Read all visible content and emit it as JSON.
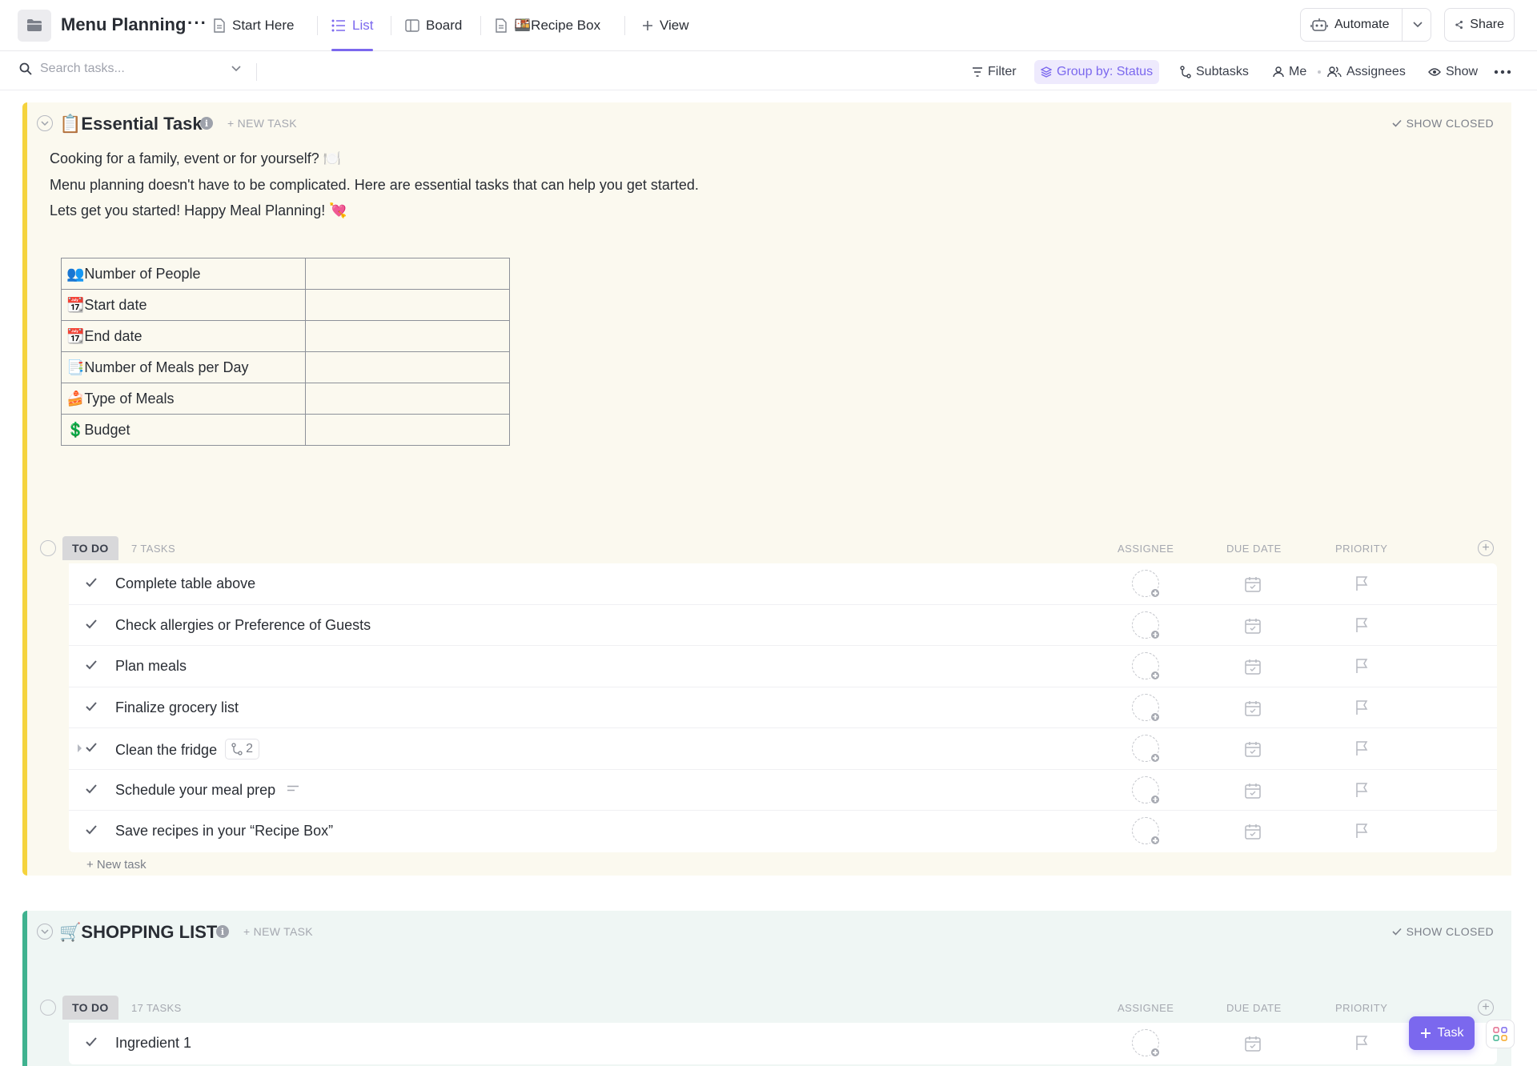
{
  "header": {
    "title": "Menu Planning",
    "title_more": "···",
    "tabs": [
      {
        "label": "Start Here",
        "icon": "doc-icon"
      },
      {
        "label": "List",
        "icon": "list-icon",
        "active": true
      },
      {
        "label": "Board",
        "icon": "board-icon"
      },
      {
        "label": "🍱Recipe Box",
        "icon": "doc-icon"
      },
      {
        "label": "View",
        "icon": "plus-icon"
      }
    ],
    "automate_label": "Automate",
    "share_label": "Share"
  },
  "toolbar": {
    "search_placeholder": "Search tasks...",
    "filter_label": "Filter",
    "group_label": "Group by: Status",
    "subtasks_label": "Subtasks",
    "me_label": "Me",
    "assignees_label": "Assignees",
    "show_label": "Show"
  },
  "essential": {
    "title": "📋Essential Task",
    "new_task_label": "+ NEW TASK",
    "show_closed": "SHOW CLOSED",
    "description": [
      "Cooking for a family, event or for yourself? 🍽️",
      "Menu planning doesn't have to be complicated. Here are essential tasks that can help you get started.",
      "Lets get you started! Happy Meal Planning! 💘"
    ],
    "table": [
      {
        "label": "👥Number of People",
        "value": ""
      },
      {
        "label": "📆Start date",
        "value": ""
      },
      {
        "label": "📆End date",
        "value": ""
      },
      {
        "label": "📑Number of Meals per Day",
        "value": ""
      },
      {
        "label": "🍰Type of Meals",
        "value": ""
      },
      {
        "label": "💲Budget",
        "value": ""
      }
    ],
    "status": "TO DO",
    "task_count": "7 TASKS",
    "columns": {
      "assignee": "ASSIGNEE",
      "due": "DUE DATE",
      "priority": "PRIORITY"
    },
    "tasks": [
      {
        "name": "Complete table above"
      },
      {
        "name": "Check allergies or Preference of Guests"
      },
      {
        "name": "Plan meals"
      },
      {
        "name": "Finalize grocery list"
      },
      {
        "name": "Clean the fridge",
        "subtasks": "2"
      },
      {
        "name": "Schedule your meal prep",
        "has_description": true
      },
      {
        "name": "Save recipes in your “Recipe Box”"
      }
    ],
    "new_task_link": "+ New task"
  },
  "shopping": {
    "title": "🛒SHOPPING LIST",
    "new_task_label": "+ NEW TASK",
    "show_closed": "SHOW CLOSED",
    "status": "TO DO",
    "task_count": "17 TASKS",
    "columns": {
      "assignee": "ASSIGNEE",
      "due": "DUE DATE",
      "priority": "PRIORITY"
    },
    "tasks": [
      {
        "name": "Ingredient 1"
      }
    ]
  },
  "fab": {
    "task_label": "Task"
  },
  "colors": {
    "accent": "#7b68ee",
    "essential_bar": "#f5d33d",
    "shopping_bar": "#3fb28f"
  }
}
